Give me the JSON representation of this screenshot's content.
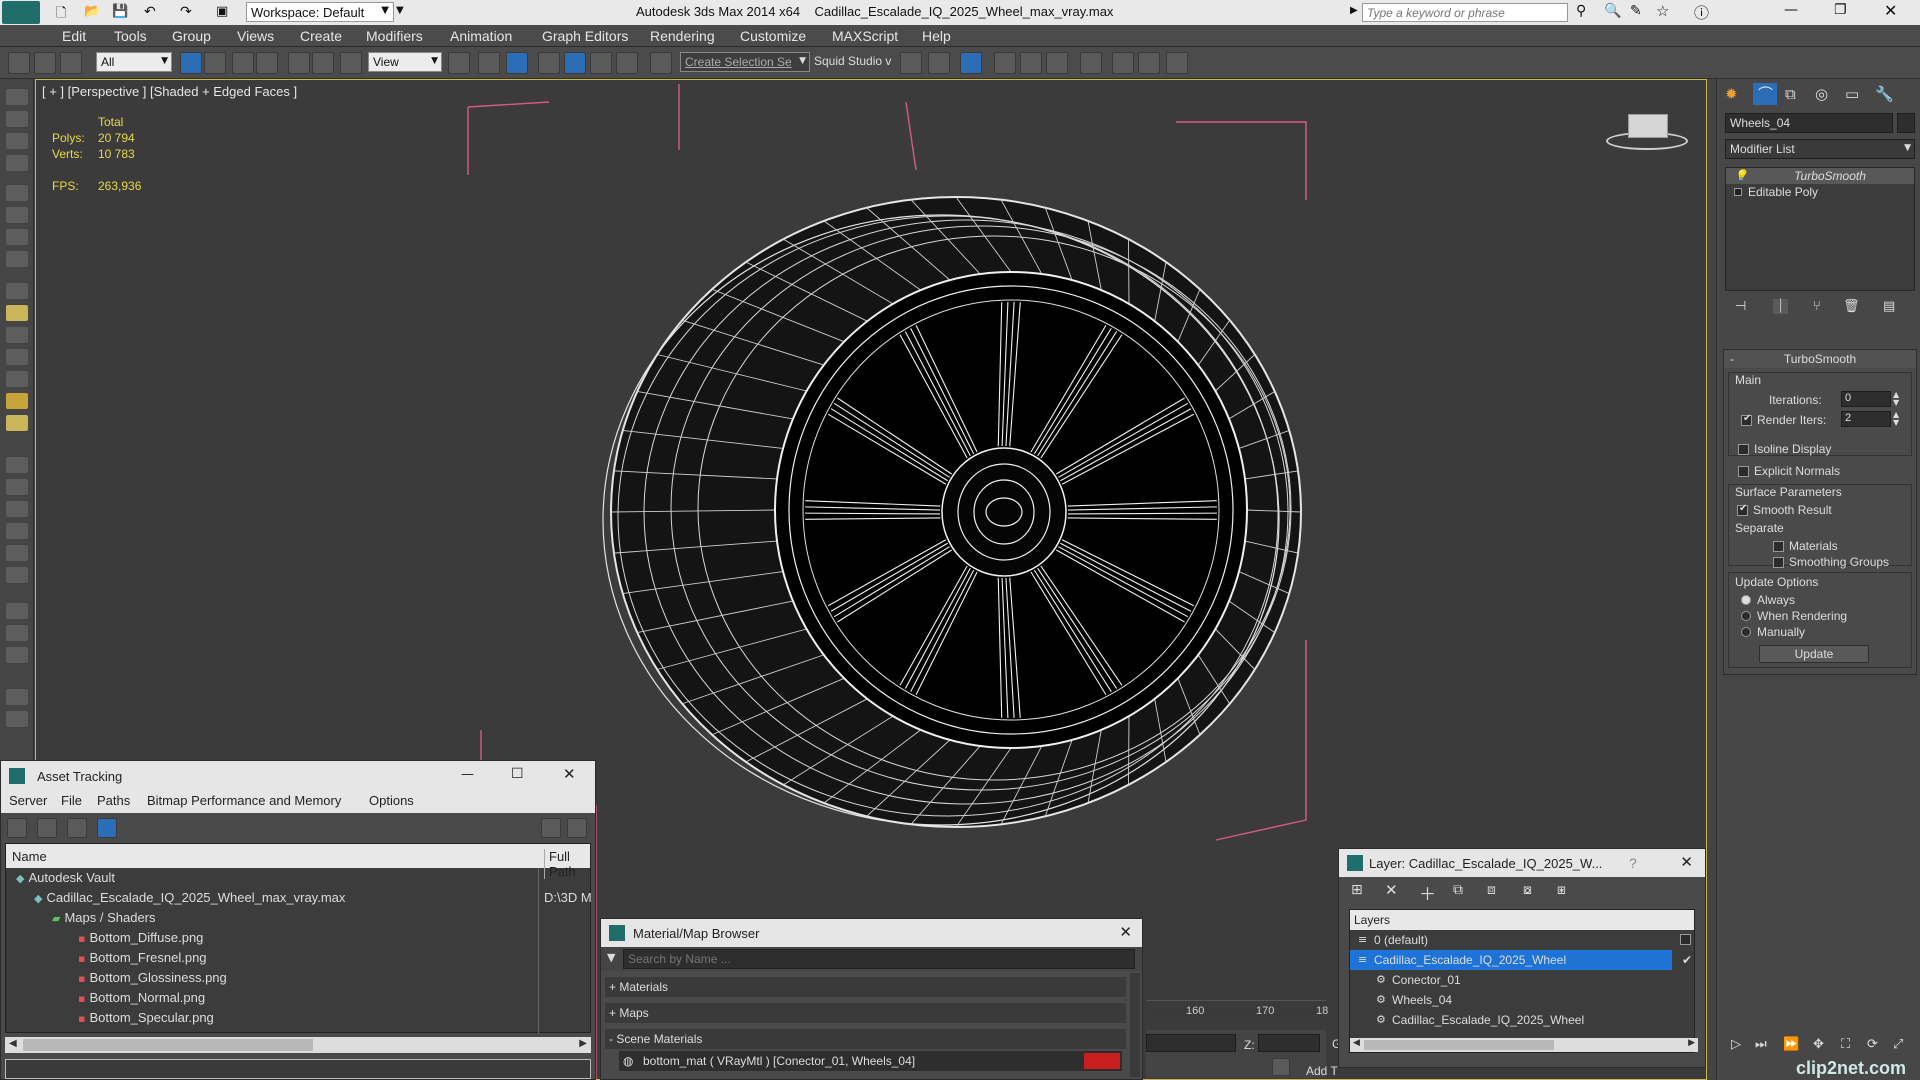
{
  "app": {
    "title": "Autodesk 3ds Max  2014 x64",
    "file": "Cadillac_Escalade_IQ_2025_Wheel_max_vray.max",
    "workspace": "Workspace: Default",
    "search_placeholder": "Type a keyword or phrase"
  },
  "menu": [
    "Edit",
    "Tools",
    "Group",
    "Views",
    "Create",
    "Modifiers",
    "Animation",
    "Graph Editors",
    "Rendering",
    "Customize",
    "MAXScript",
    "Help"
  ],
  "toolbar": {
    "filter": "All",
    "ref_coord": "View",
    "selection_set": "Create Selection Se",
    "squid": "Squid Studio v"
  },
  "viewport": {
    "label": "[ + ] [Perspective ] [Shaded + Edged Faces ]",
    "stats": {
      "total_label": "Total",
      "polys_label": "Polys:",
      "polys": "20 794",
      "verts_label": "Verts:",
      "verts": "10 783",
      "fps_label": "FPS:",
      "fps": "263,936"
    }
  },
  "command_panel": {
    "object_name": "Wheels_04",
    "modifier_list": "Modifier List",
    "stack": [
      "TurboSmooth",
      "Editable Poly"
    ],
    "rollout_title": "TurboSmooth",
    "main_label": "Main",
    "iterations_label": "Iterations:",
    "iterations": "0",
    "render_iters_label": "Render Iters:",
    "render_iters": "2",
    "isoline": "Isoline Display",
    "explicit_normals": "Explicit Normals",
    "surface_params": "Surface Parameters",
    "smooth_result": "Smooth Result",
    "separate": "Separate",
    "materials": "Materials",
    "smoothing_groups": "Smoothing Groups",
    "update_options": "Update Options",
    "always": "Always",
    "when_rendering": "When Rendering",
    "manually": "Manually",
    "update_button": "Update"
  },
  "asset_tracking": {
    "title": "Asset Tracking",
    "menu": [
      "Server",
      "File",
      "Paths",
      "Bitmap Performance and Memory",
      "Options"
    ],
    "col_name": "Name",
    "col_path": "Full Path",
    "rows": [
      {
        "name": "Autodesk Vault",
        "path": "",
        "indent": 0
      },
      {
        "name": "Cadillac_Escalade_IQ_2025_Wheel_max_vray.max",
        "path": "D:\\3D M",
        "indent": 1
      },
      {
        "name": "Maps / Shaders",
        "path": "",
        "indent": 2
      },
      {
        "name": "Bottom_Diffuse.png",
        "path": "",
        "indent": 3
      },
      {
        "name": "Bottom_Fresnel.png",
        "path": "",
        "indent": 3
      },
      {
        "name": "Bottom_Glossiness.png",
        "path": "",
        "indent": 3
      },
      {
        "name": "Bottom_Normal.png",
        "path": "",
        "indent": 3
      },
      {
        "name": "Bottom_Specular.png",
        "path": "",
        "indent": 3
      }
    ]
  },
  "material_browser": {
    "title": "Material/Map Browser",
    "search_placeholder": "Search by Name ...",
    "materials": "+ Materials",
    "maps": "+ Maps",
    "scene_materials": "- Scene Materials",
    "item": "bottom_mat  ( VRayMtl )  [Conector_01, Wheels_04]"
  },
  "layer_panel": {
    "title": "Layer: Cadillac_Escalade_IQ_2025_W...",
    "help": "?",
    "header": "Layers",
    "rows": [
      {
        "name": "0 (default)",
        "indent": 0,
        "selected": false
      },
      {
        "name": "Cadillac_Escalade_IQ_2025_Wheel",
        "indent": 0,
        "selected": true
      },
      {
        "name": "Conector_01",
        "indent": 1,
        "selected": false
      },
      {
        "name": "Wheels_04",
        "indent": 1,
        "selected": false
      },
      {
        "name": "Cadillac_Escalade_IQ_2025_Wheel",
        "indent": 1,
        "selected": false
      }
    ]
  },
  "timeline": {
    "ticks": [
      "160",
      "170",
      "18"
    ],
    "z_label": "Z:",
    "grid_label": "Grid =",
    "add_label": "Add T"
  },
  "watermark": "clip2net.com",
  "colors": {
    "accent_blue": "#1e73d6",
    "viewport_border": "#c8b84a",
    "stats_yellow": "#e8d84a",
    "bbox_pink": "#d65c7f"
  }
}
